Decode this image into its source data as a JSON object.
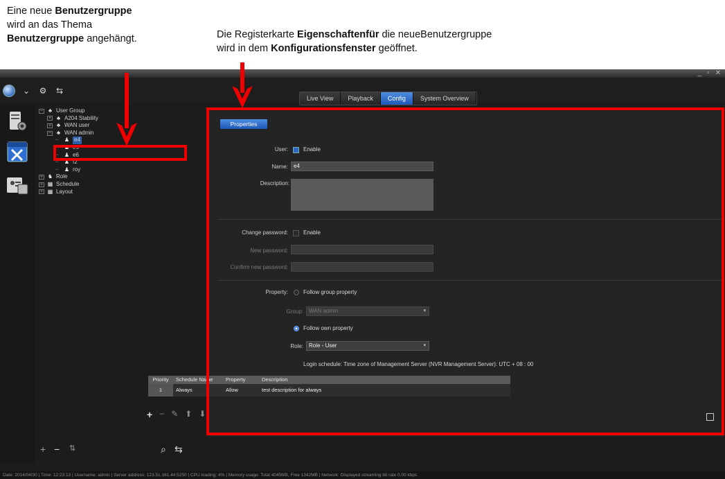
{
  "annotation_left": {
    "line1_pre": "Eine neue ",
    "line1_bold": "Benutzergruppe",
    "line2": "wird an das Thema",
    "line3_bold": "Benutzergruppe",
    "line3_post": " angehängt."
  },
  "annotation_right": {
    "line1_pre": "Die Registerkarte ",
    "line1_bold": "Eigenschaftenfür",
    "line1_post": " die neueBenutzergruppe",
    "line2_pre": "wird in dem ",
    "line2_bold": "Konfigurationsfenster",
    "line2_post": " geöffnet."
  },
  "window_controls": {
    "minimize": "_",
    "restore": "▫",
    "close": "✕"
  },
  "tabs": [
    {
      "label": "Live View",
      "active": false
    },
    {
      "label": "Playback",
      "active": false
    },
    {
      "label": "Config",
      "active": true
    },
    {
      "label": "System Overview",
      "active": false
    }
  ],
  "tree": [
    {
      "label": "User Group",
      "level": 0,
      "expander": "⊟",
      "icon": "group-icon"
    },
    {
      "label": "A204 Stability",
      "level": 1,
      "expander": "⊞",
      "icon": "group-icon"
    },
    {
      "label": "WAN user",
      "level": 1,
      "expander": "⊞",
      "icon": "group-icon"
    },
    {
      "label": "WAN admin",
      "level": 1,
      "expander": "⊟",
      "icon": "group-icon"
    },
    {
      "label": "e4",
      "level": 2,
      "expander": "",
      "icon": "user-icon",
      "selected": true
    },
    {
      "label": "e5",
      "level": 2,
      "expander": "",
      "icon": "user-icon"
    },
    {
      "label": "e6",
      "level": 2,
      "expander": "",
      "icon": "user-icon"
    },
    {
      "label": "f2",
      "level": 2,
      "expander": "",
      "icon": "user-icon"
    },
    {
      "label": "roy",
      "level": 2,
      "expander": "",
      "icon": "user-icon"
    },
    {
      "label": "Role",
      "level": 0,
      "expander": "⊞",
      "icon": "role-icon"
    },
    {
      "label": "Schedule",
      "level": 0,
      "expander": "⊞",
      "icon": "schedule-icon"
    },
    {
      "label": "Layout",
      "level": 0,
      "expander": "⊞",
      "icon": "layout-icon"
    }
  ],
  "tree_tools": {
    "add": "+",
    "remove": "−",
    "sort": "⇅",
    "search": "⌕",
    "filter": "⇆"
  },
  "panel": {
    "properties_label": "Properties",
    "user_label": "User:",
    "enable_label": "Enable",
    "name_label": "Name:",
    "name_value": "e4",
    "description_label": "Description:",
    "description_value": "",
    "change_password_label": "Change password:",
    "change_password_enable": "Enable",
    "new_password_label": "New password:",
    "confirm_password_label": "Confirm new password:",
    "property_label": "Property:",
    "follow_group": "Follow group property",
    "group_label": "Group:",
    "group_value": "WAN admin",
    "follow_own": "Follow own property",
    "role_label": "Role:",
    "role_value": "Role - User",
    "login_schedule": "Login schedule:  Time zone of Management Server (NVR Management Server): UTC + 08 : 00"
  },
  "schedule_table": {
    "headers": [
      "Priority",
      "Schedule Name",
      "Property",
      "Description"
    ],
    "rows": [
      {
        "priority": "1",
        "name": "Always",
        "property": "Allow",
        "description": "test description for always"
      }
    ]
  },
  "statusbar": "Date: 2014/04/30  |  Time: 12:23:13  |  Username: admin  |  Server address: 123.51.161.44:5250  |  CPU loading: 4%  |  Memory usage: Total 4045MB, Free 1342MB  |  Network: Displayed streaming bit rate     0.00 kbps",
  "colors": {
    "highlight_red": "#ee0000",
    "accent_blue": "#2b66c8",
    "background": "#1c1c1c"
  }
}
